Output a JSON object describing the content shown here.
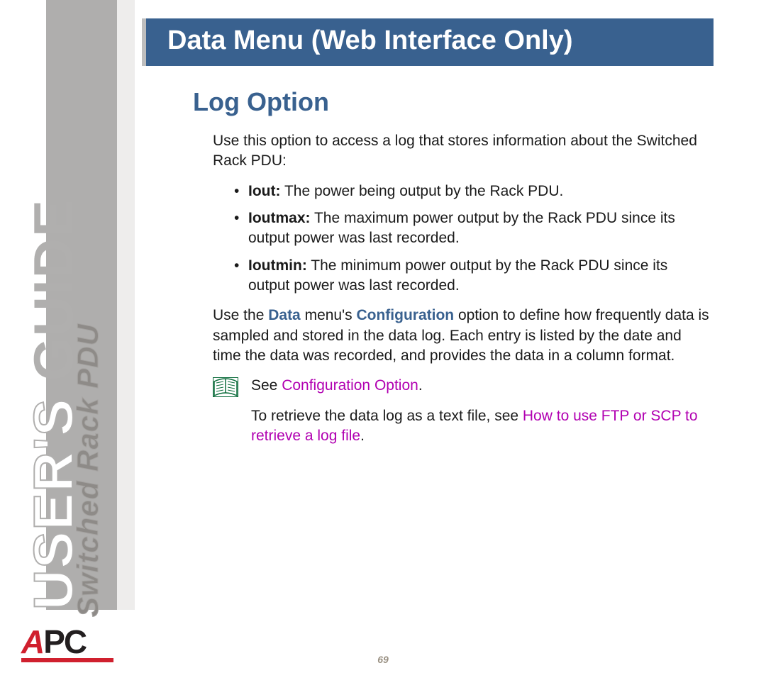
{
  "sidebar": {
    "guide_outlined": "USER'S",
    "guide_solid": " GUIDE",
    "subtitle": "Switched Rack PDU",
    "logo_a": "A",
    "logo_pc": "PC"
  },
  "page": {
    "title": "Data Menu (Web Interface Only)",
    "section_heading": "Log Option",
    "intro": "Use this option to access a log that stores information about the Switched Rack PDU:",
    "bullets": [
      {
        "term": "Iout:",
        "desc": " The power being output by the Rack PDU."
      },
      {
        "term": "Ioutmax:",
        "desc": " The maximum power output by the Rack PDU since its output power was last recorded."
      },
      {
        "term": "Ioutmin:",
        "desc": " The minimum power output by the Rack PDU since its output power was last recorded."
      }
    ],
    "para2_pre": "Use the ",
    "para2_b1": "Data",
    "para2_mid1": " menu's ",
    "para2_b2": "Configuration",
    "para2_post": " option to define how frequently data is sampled and stored in the data log. Each entry is listed by the date and time the data was recorded, and provides the data in a column format.",
    "note1_pre": "See ",
    "note1_link": "Configuration Option",
    "note1_post": ".",
    "note2_pre": "To retrieve the data log as a text file, see ",
    "note2_link": "How to use FTP or SCP to retrieve a log file",
    "note2_post": ".",
    "page_number": "69"
  }
}
